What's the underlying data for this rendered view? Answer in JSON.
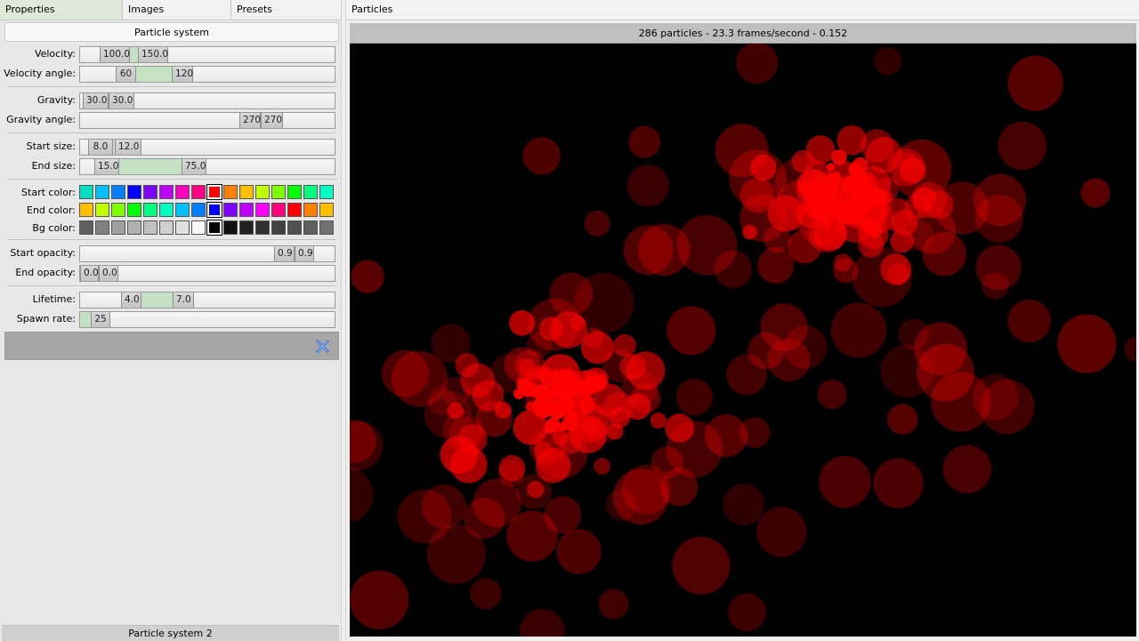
{
  "tabs": [
    "Properties",
    "Images",
    "Presets"
  ],
  "panel_title": "Particle system",
  "properties": {
    "velocity": {
      "label": "Velocity:",
      "min": "100.0",
      "max": "150.0"
    },
    "velocity_angle": {
      "label": "Velocity angle:",
      "min": "60",
      "max": "120"
    },
    "gravity": {
      "label": "Gravity:",
      "min": "30.0",
      "max": "30.0"
    },
    "gravity_angle": {
      "label": "Gravity angle:",
      "min": "270",
      "max": "270"
    },
    "start_size": {
      "label": "Start size:",
      "min": "8.0",
      "max": "12.0"
    },
    "end_size": {
      "label": "End size:",
      "min": "15.0",
      "max": "75.0"
    },
    "start_color": {
      "label": "Start color:"
    },
    "end_color": {
      "label": "End color:"
    },
    "bg_color": {
      "label": "Bg color:"
    },
    "start_opacity": {
      "label": "Start opacity:",
      "min": "0.9",
      "max": "0.9"
    },
    "end_opacity": {
      "label": "End opacity:",
      "min": "0.0",
      "max": "0.0"
    },
    "lifetime": {
      "label": "Lifetime:",
      "min": "4.0",
      "max": "7.0"
    },
    "spawn_rate": {
      "label": "Spawn rate:",
      "value": "25"
    }
  },
  "palettes": {
    "start": {
      "colors": [
        "#00e0c0",
        "#00c0ff",
        "#0080ff",
        "#0000ff",
        "#8000ff",
        "#c000ff",
        "#ff00c0",
        "#ff0080",
        "#ff0000",
        "#ff8000",
        "#ffc000",
        "#c0ff00",
        "#80ff00",
        "#00ff00",
        "#00ff80",
        "#00ffc0"
      ],
      "selected": 8
    },
    "end": {
      "colors": [
        "#ffc000",
        "#c0ff00",
        "#80ff00",
        "#00ff00",
        "#00ff80",
        "#00ffc0",
        "#00c0ff",
        "#0080ff",
        "#0000ff",
        "#8000ff",
        "#c000ff",
        "#ff00ff",
        "#ff0080",
        "#ff0000",
        "#ff8000",
        "#ffc000"
      ],
      "selected": 8
    },
    "bg": {
      "colors": [
        "#606060",
        "#808080",
        "#a0a0a0",
        "#b0b0b0",
        "#c0c0c0",
        "#d0d0d0",
        "#e0e0e0",
        "#f8f8f8",
        "#000000",
        "#101010",
        "#202020",
        "#303030",
        "#404040",
        "#505050",
        "#606060",
        "#707070"
      ],
      "selected": 8
    }
  },
  "close_icon": "close-x-icon",
  "footer_label": "Particle system 2",
  "view_title": "Particles",
  "status_text": "286 particles - 23.3 frames/second - 0.152",
  "particle_color": "#ff0000",
  "background_color": "#000000"
}
